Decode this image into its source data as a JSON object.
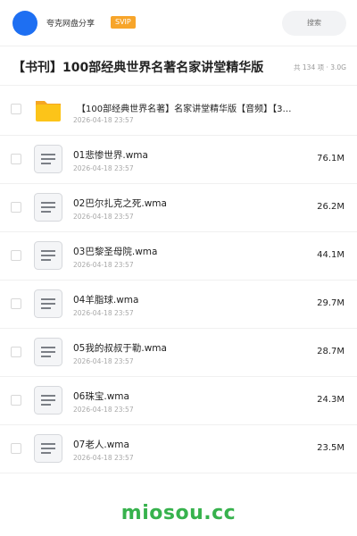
{
  "header": {
    "brand": "夸克网盘分享",
    "badge": "SVIP",
    "search_placeholder": "搜索"
  },
  "share": {
    "title": "【书刊】100部经典世界名著名家讲堂精华版",
    "meta": "共 134 项 · 3.0G"
  },
  "files": [
    {
      "name": "【100部经典世界名著】名家讲堂精华版【音频】【3…",
      "date": "2026-04-18 23:57",
      "size": "",
      "type": "folder"
    },
    {
      "name": "01悲惨世界.wma",
      "date": "2026-04-18 23:57",
      "size": "76.1M",
      "type": "file"
    },
    {
      "name": "02巴尔扎克之死.wma",
      "date": "2026-04-18 23:57",
      "size": "26.2M",
      "type": "file"
    },
    {
      "name": "03巴黎圣母院.wma",
      "date": "2026-04-18 23:57",
      "size": "44.1M",
      "type": "file"
    },
    {
      "name": "04羊脂球.wma",
      "date": "2026-04-18 23:57",
      "size": "29.7M",
      "type": "file"
    },
    {
      "name": "05我的叔叔于勒.wma",
      "date": "2026-04-18 23:57",
      "size": "28.7M",
      "type": "file"
    },
    {
      "name": "06珠宝.wma",
      "date": "2026-04-18 23:57",
      "size": "24.3M",
      "type": "file"
    },
    {
      "name": "07老人.wma",
      "date": "2026-04-18 23:57",
      "size": "23.5M",
      "type": "file"
    }
  ],
  "icons": {
    "folder": "folder-icon",
    "file": "document-icon"
  },
  "colors": {
    "accent": "#1e6ff2",
    "badge": "#f7a52a",
    "folder": "#fcc419",
    "watermark": "#37b24d"
  },
  "watermark": "miosou.cc"
}
